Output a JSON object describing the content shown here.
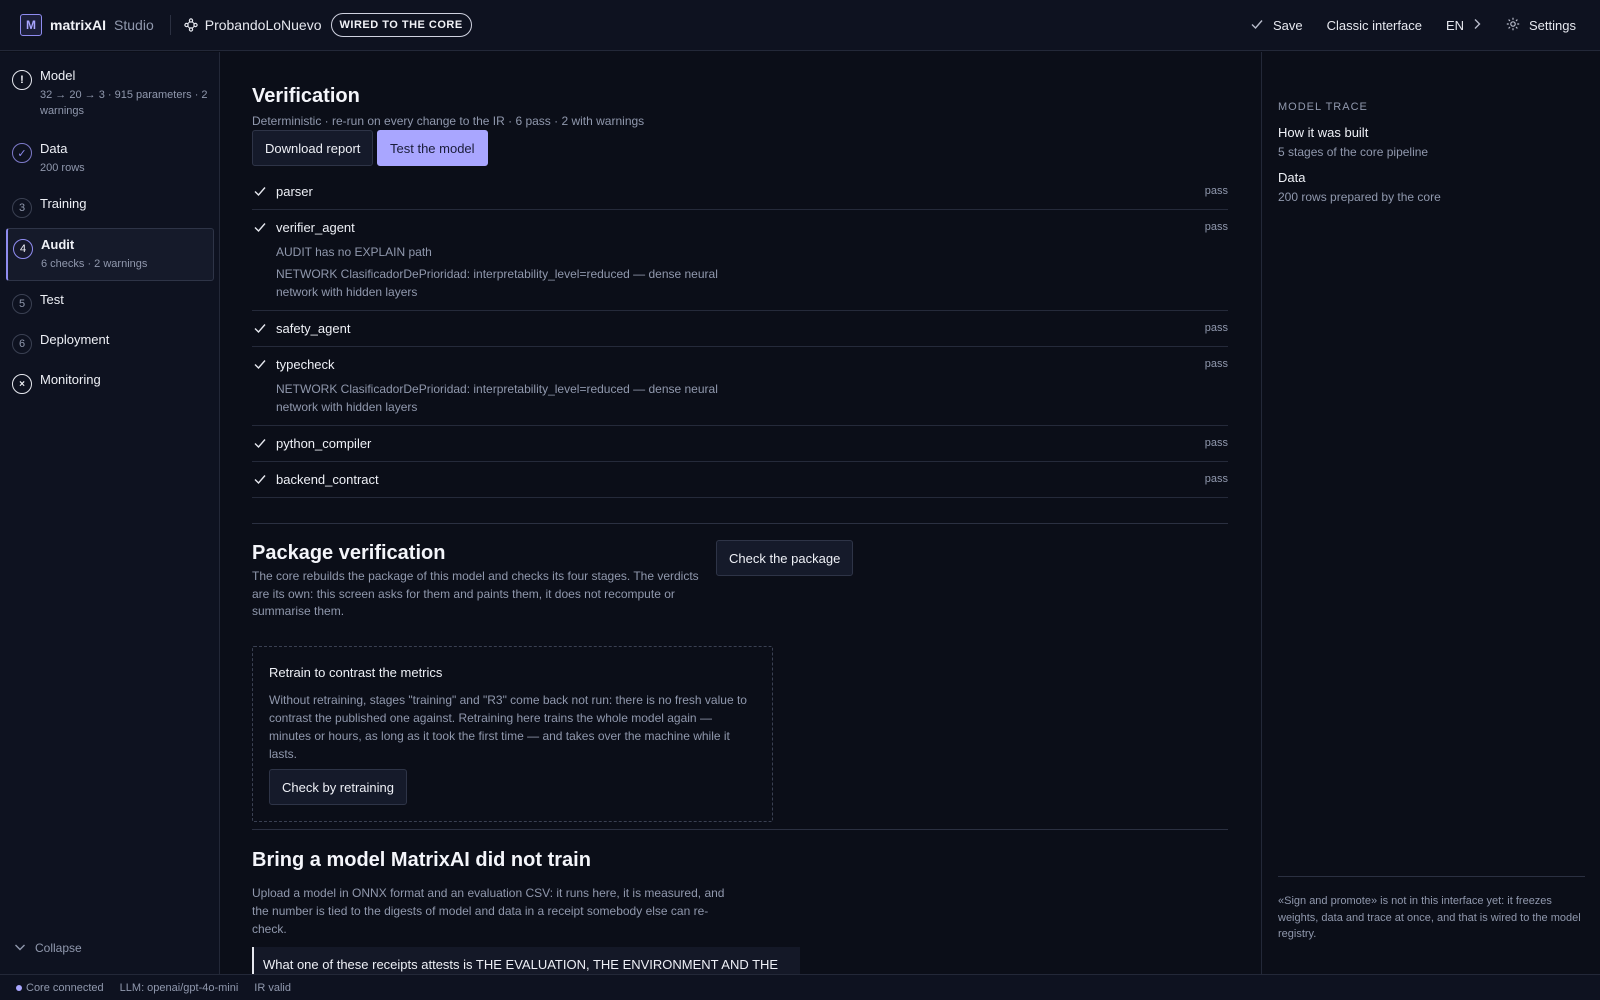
{
  "topbar": {
    "logo_letter": "M",
    "brand": "matrixAI",
    "product": "Studio",
    "project_name": "ProbandoLoNuevo",
    "pill": "WIRED TO THE CORE",
    "save": "Save",
    "classic": "Classic interface",
    "language": "EN",
    "settings": "Settings"
  },
  "sidebar": {
    "steps": [
      {
        "marker": "!",
        "title": "Model",
        "sub": "32 → 20 → 3 · 915 parameters · 2 warnings"
      },
      {
        "marker": "✓",
        "title": "Data",
        "sub": "200 rows"
      },
      {
        "marker": "3",
        "title": "Training"
      },
      {
        "marker": "4",
        "title": "Audit",
        "sub": "6 checks · 2 warnings"
      },
      {
        "marker": "5",
        "title": "Test"
      },
      {
        "marker": "6",
        "title": "Deployment"
      },
      {
        "marker": "×",
        "title": "Monitoring"
      }
    ],
    "collapse": "Collapse"
  },
  "verification": {
    "title": "Verification",
    "subtitle": "Deterministic · re-run on every change to the IR · 6 pass · 2 with warnings",
    "download_report": "Download report",
    "test_model": "Test the model",
    "checks": [
      {
        "name": "parser",
        "status": "pass"
      },
      {
        "name": "verifier_agent",
        "status": "pass",
        "notes": [
          "AUDIT has no EXPLAIN path",
          "NETWORK ClasificadorDePrioridad: interpretability_level=reduced — dense neural network with hidden layers"
        ]
      },
      {
        "name": "safety_agent",
        "status": "pass"
      },
      {
        "name": "typecheck",
        "status": "pass",
        "notes": [
          "NETWORK ClasificadorDePrioridad: interpretability_level=reduced — dense neural network with hidden layers"
        ]
      },
      {
        "name": "python_compiler",
        "status": "pass"
      },
      {
        "name": "backend_contract",
        "status": "pass"
      }
    ]
  },
  "package": {
    "title": "Package verification",
    "description": "The core rebuilds the package of this model and checks its four stages. The verdicts are its own: this screen asks for them and paints them, it does not recompute or summarise them.",
    "check_button": "Check the package",
    "retrain": {
      "title": "Retrain to contrast the metrics",
      "description": "Without retraining, stages \"training\" and \"R3\" come back not run: there is no fresh value to contrast the published one against. Retraining here trains the whole model again — minutes or hours, as long as it took the first time — and takes over the machine while it lasts.",
      "button": "Check by retraining"
    }
  },
  "bring": {
    "title": "Bring a model MatrixAI did not train",
    "description": "Upload a model in ONNX format and an evaluation CSV: it runs here, it is measured, and the number is tied to the digests of model and data in a receipt somebody else can re-check.",
    "quote": "What one of these receipts attests is THE EVALUATION, THE ENVIRONMENT AND THE"
  },
  "trace": {
    "heading": "MODEL TRACE",
    "items": [
      {
        "title": "How it was built",
        "sub": "5 stages of the core pipeline"
      },
      {
        "title": "Data",
        "sub": "200 rows prepared by the core"
      }
    ],
    "note": "«Sign and promote» is not in this interface yet: it freezes weights, data and trace at once, and that is wired to the model registry."
  },
  "status": {
    "core": "Core connected",
    "llm": "LLM: openai/gpt-4o-mini",
    "ir": "IR valid"
  },
  "colors": {
    "accent": "#a9a6ff",
    "background": "#0b0e18",
    "panel": "#0e1220"
  }
}
